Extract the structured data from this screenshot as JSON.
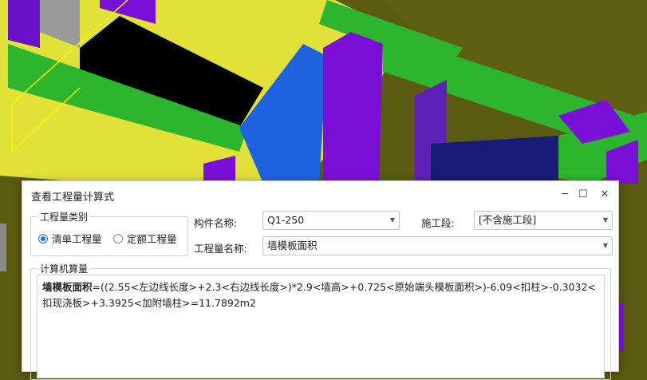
{
  "dialog": {
    "title": "查看工程量计算式",
    "window_buttons": {
      "minimize": "─",
      "maximize": "☐",
      "close": "✕"
    }
  },
  "quantity_type": {
    "legend": "工程量类别",
    "options": [
      {
        "label": "清单工程量",
        "checked": true
      },
      {
        "label": "定额工程量",
        "checked": false
      }
    ]
  },
  "component_name": {
    "label": "构件名称:",
    "value": "Q1-250"
  },
  "construction_section": {
    "label": "施工段:",
    "value": "[不含施工段]"
  },
  "quantity_name": {
    "label": "工程量名称:",
    "value": "墙模板面积"
  },
  "calculation": {
    "legend": "计算机算量",
    "formula_label": "墙模板面积",
    "formula_text": "=((2.55<左边线长度>+2.3<右边线长度>)*2.9<墙高>+0.725<原始端头模板面积>)-6.09<扣柱>-0.3032<扣现浇板>+3.3925<加附墙柱>=11.7892m2"
  },
  "colors": {
    "accent": "#1a73e8",
    "scene_yellow": "#e1e13a",
    "scene_green": "#2db52d",
    "scene_purple": "#7a10d8",
    "scene_blue": "#1e62e0"
  }
}
